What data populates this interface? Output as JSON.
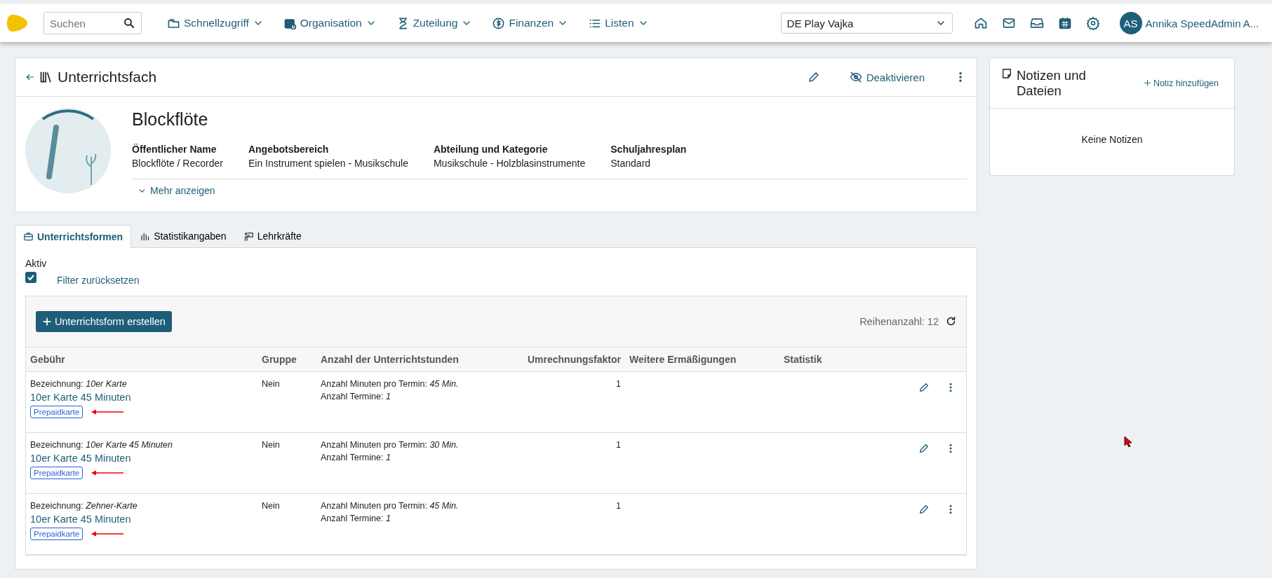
{
  "topbar": {
    "search": {
      "placeholder": "Suchen"
    },
    "menus": [
      {
        "label": "Schnellzugriff"
      },
      {
        "label": "Organisation"
      },
      {
        "label": "Zuteilung"
      },
      {
        "label": "Finanzen"
      },
      {
        "label": "Listen"
      }
    ],
    "school_select": {
      "value": "DE Play Vajka"
    },
    "user": {
      "initials": "AS",
      "name": "Annika SpeedAdmin A..."
    }
  },
  "header": {
    "title": "Unterrichtsfach",
    "actions": {
      "deactivate": "Deaktivieren"
    },
    "subject": "Blockflöte",
    "fields": [
      {
        "label": "Öffentlicher Name",
        "value": "Blockflöte / Recorder"
      },
      {
        "label": "Angebotsbereich",
        "value": "Ein Instrument spielen - Musikschule"
      },
      {
        "label": "Abteilung und Kategorie",
        "value": "Musikschule - Holzblasinstrumente"
      },
      {
        "label": "Schuljahresplan",
        "value": "Standard"
      }
    ],
    "more": "Mehr anzeigen"
  },
  "tabs": [
    {
      "label": "Unterrichtsformen",
      "selected": true
    },
    {
      "label": "Statistikangaben",
      "selected": false
    },
    {
      "label": "Lehrkräfte",
      "selected": false
    }
  ],
  "filter": {
    "label": "Aktiv",
    "checked": true,
    "reset": "Filter zurücksetzen"
  },
  "table": {
    "create_button": "Unterrichtsform erstellen",
    "row_count": "Reihenanzahl: 12",
    "columns": [
      "Gebühr",
      "Gruppe",
      "Anzahl der Unterrichtstunden",
      "Umrechnungsfaktor",
      "Weitere Ermäßigungen",
      "Statistik"
    ],
    "rows": [
      {
        "designation": "Bezeichnung: *10er Karte*",
        "link": "10er Karte 45 Minuten",
        "badge": "Prepaidkarte",
        "annotated": true,
        "group": "Nein",
        "minutes": "Anzahl Minuten pro Termin: *45 Min.*",
        "count": "Anzahl Termine: *1*",
        "factor": "1"
      },
      {
        "designation": "Bezeichnung: *10er Karte 45 Minuten*",
        "link": "10er Karte 45 Minuten",
        "badge": "Prepaidkarte",
        "annotated": true,
        "group": "Nein",
        "minutes": "Anzahl Minuten pro Termin: *30 Min.*",
        "count": "Anzahl Termine: *1*",
        "factor": "1"
      },
      {
        "designation": "Bezeichnung: *Zehner-Karte*",
        "link": "10er Karte 45 Minuten",
        "badge": "Prepaidkarte",
        "annotated": true,
        "group": "Nein",
        "minutes": "Anzahl Minuten pro Termin: *45 Min.*",
        "count": "Anzahl Termine: *1*",
        "factor": "1"
      }
    ]
  },
  "notes": {
    "title": "Notizen und Dateien",
    "add": "Notiz hinzufügen",
    "empty": "Keine Notizen"
  },
  "cursor": true
}
